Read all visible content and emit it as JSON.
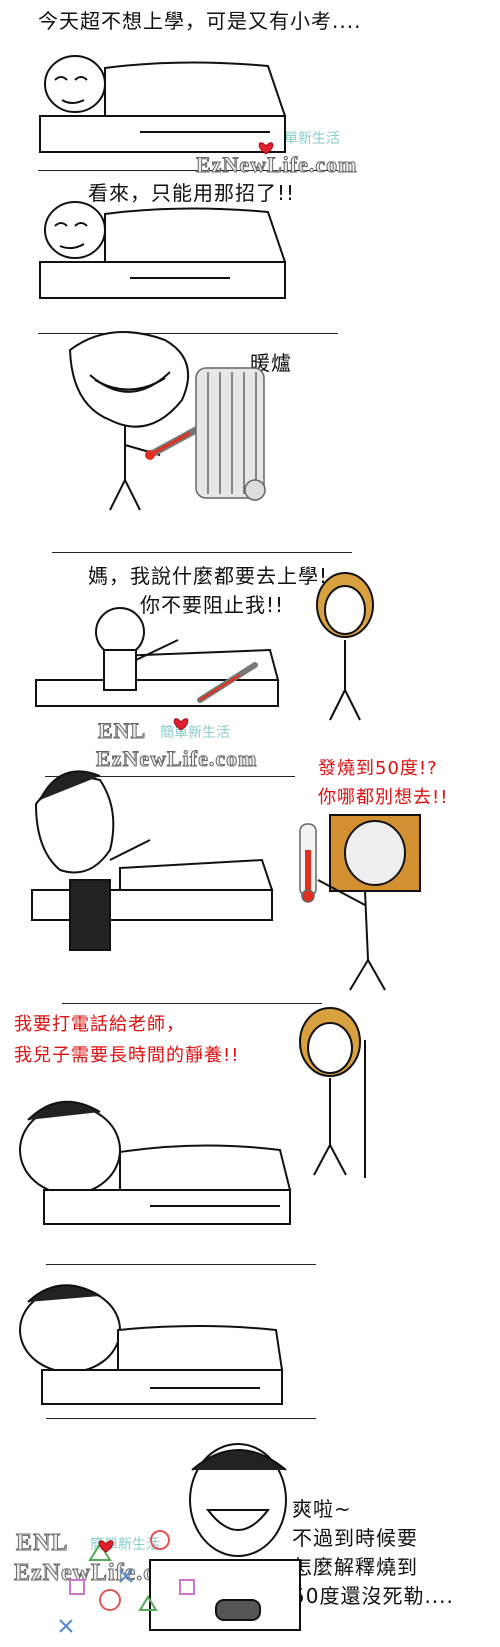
{
  "panels": [
    {
      "caption": "今天超不想上學，可是又有小考...."
    },
    {
      "caption": "看來，只能用那招了!!"
    },
    {
      "caption": "暖爐"
    },
    {
      "caption_line1": "媽，我說什麼都要去上學!",
      "caption_line2": "你不要阻止我!!"
    },
    {
      "caption_line1": "發燒到50度!?",
      "caption_line2": "你哪都別想去!!"
    },
    {
      "caption_line1": "我要打電話給老師，",
      "caption_line2": "我兒子需要長時間的靜養!!"
    },
    {
      "caption": ""
    },
    {
      "caption": ""
    },
    {
      "caption_line1": "爽啦~",
      "caption_line2": "不過到時候要",
      "caption_line3": "怎麼解釋燒到",
      "caption_line4": "50度還沒死勒...."
    }
  ],
  "watermark": {
    "logo": "ENL",
    "site": "EzNewLife.com",
    "cn": "簡單新生活"
  },
  "colors": {
    "red_text": "#dd1111",
    "thermometer_red": "#e03020",
    "heart": "#e02030"
  }
}
